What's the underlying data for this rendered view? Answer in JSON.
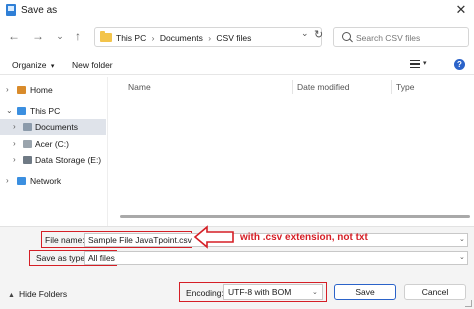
{
  "window": {
    "title": "Save as",
    "close_glyph": "✕"
  },
  "nav": {
    "back_glyph": "←",
    "forward_glyph": "→",
    "dropdown_glyph": "⌄",
    "up_glyph": "↑"
  },
  "address": {
    "crumbs": [
      "This PC",
      "Documents",
      "CSV files"
    ],
    "separator": "›",
    "chevron_glyph": "⌄",
    "refresh_glyph": "↻"
  },
  "search": {
    "placeholder": "Search CSV files"
  },
  "commandbar": {
    "organize_label": "Organize",
    "organize_caret": "▾",
    "new_folder_label": "New folder",
    "view_caret": "▾",
    "help_glyph": "?"
  },
  "sidebar": {
    "items": [
      {
        "label": "Home",
        "icon": "home-icon",
        "chevron": "›"
      },
      {
        "label": "This PC",
        "icon": "computer-icon",
        "chevron": "⌄"
      },
      {
        "label": "Documents",
        "icon": "documents-icon",
        "chevron": "›",
        "selected": true
      },
      {
        "label": "Acer (C:)",
        "icon": "drive-icon",
        "chevron": "›"
      },
      {
        "label": "Data Storage (E:)",
        "icon": "drive-icon",
        "chevron": "›"
      },
      {
        "label": "Network",
        "icon": "network-icon",
        "chevron": "›"
      }
    ]
  },
  "columns": {
    "name": "Name",
    "date_modified": "Date modified",
    "type": "Type"
  },
  "form": {
    "file_name_label": "File name:",
    "file_name_value": "Sample File JavaTpoint.csv",
    "save_as_type_label": "Save as type:",
    "save_as_type_value": "All files",
    "encoding_label": "Encoding:",
    "encoding_value": "UTF-8 with BOM",
    "dropdown_glyph": "⌄"
  },
  "annotation": {
    "text": "with .csv extension, not txt",
    "color": "#d51f26"
  },
  "footer": {
    "hide_folders_label": "Hide Folders",
    "hide_folders_caret": "▲",
    "save_label": "Save",
    "cancel_label": "Cancel"
  },
  "colors": {
    "accent": "#2b63c9",
    "highlight": "#d51f26",
    "selection": "#dfe3ea"
  }
}
